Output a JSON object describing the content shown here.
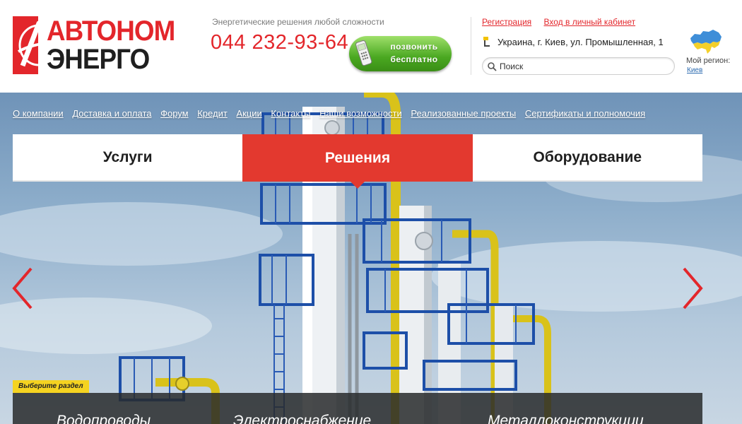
{
  "brand": {
    "line1": "АВТОНОМ",
    "line2": "ЭНЕРГО",
    "tagline": "Энергетические решения любой сложности",
    "phone": "044 232-93-64",
    "accent_color": "#e3262b"
  },
  "call_button": {
    "line1": "позвонить",
    "line2": "бесплатно",
    "icon": "mobile-phone-icon"
  },
  "account": {
    "register": "Регистрация",
    "login": "Вход в личный кабинет"
  },
  "address": "Украина, г. Киев, ул. Промышленная, 1",
  "search": {
    "placeholder": "Поиск",
    "icon": "search-icon"
  },
  "region": {
    "label": "Мой регион:",
    "city": "Киев",
    "icon": "ukraine-map-icon"
  },
  "nav": [
    "О компании",
    "Доставка и оплата",
    "Форум",
    "Кредит",
    "Акции",
    "Контакты",
    "Наши возможности",
    "Реализованные проекты",
    "Сертификаты и полномочия"
  ],
  "tabs": [
    {
      "label": "Услуги",
      "active": false
    },
    {
      "label": "Решения",
      "active": true
    },
    {
      "label": "Оборудование",
      "active": false
    }
  ],
  "sections": {
    "badge": "Выберите раздел",
    "items": [
      "Водопроводы",
      "Электроснабжение",
      "Металлоконструкции"
    ],
    "badge_color": "#f5d321"
  },
  "slider": {
    "prev_icon": "chevron-left-icon",
    "next_icon": "chevron-right-icon",
    "arrow_color": "#e3262b"
  }
}
